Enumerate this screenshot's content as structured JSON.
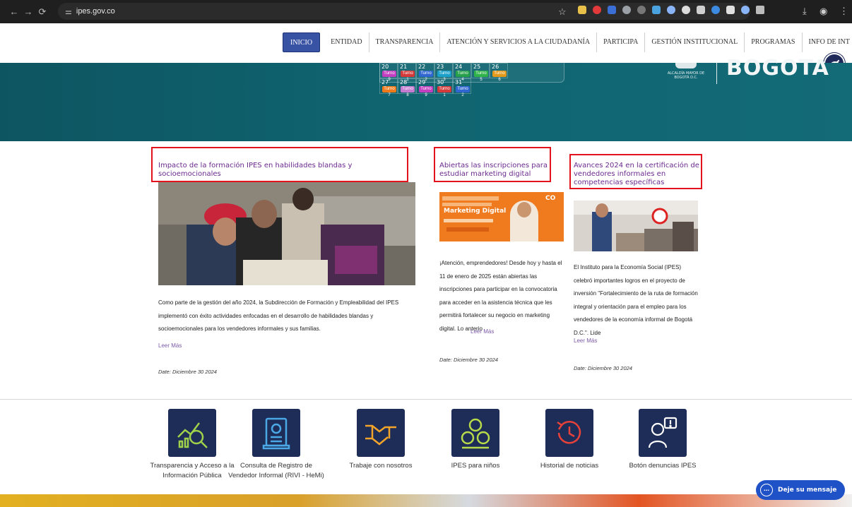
{
  "browser": {
    "url": "ipes.gov.co"
  },
  "nav": {
    "items": [
      "INICIO",
      "ENTIDAD",
      "TRANSPARENCIA",
      "ATENCIÓN Y SERVICIOS A LA CIUDADANÍA",
      "PARTICIPA",
      "GESTIÓN INSTITUCIONAL",
      "PROGRAMAS",
      "INFO DE INT"
    ]
  },
  "calendar": {
    "row1": [
      {
        "day": "20",
        "tag": "Turno 9",
        "color": "#c23fbf"
      },
      {
        "day": "21",
        "tag": "Turno 1",
        "color": "#d43a3a"
      },
      {
        "day": "22",
        "tag": "Turno 2",
        "color": "#2f66d0"
      },
      {
        "day": "23",
        "tag": "Turno 3",
        "color": "#1aa0c9"
      },
      {
        "day": "24",
        "tag": "Turno 4",
        "color": "#26a04a"
      },
      {
        "day": "25",
        "tag": "Turno 5",
        "color": "#31b34b"
      },
      {
        "day": "26",
        "tag": "Turno 6",
        "color": "#e39a1c"
      }
    ],
    "row2": [
      {
        "day": "27",
        "tag": "Turno 7",
        "color": "#f07a1a"
      },
      {
        "day": "28",
        "tag": "Turno 8",
        "color": "#c57bd0"
      },
      {
        "day": "29",
        "tag": "Turno 9",
        "color": "#c23fbf"
      },
      {
        "day": "30",
        "tag": "Turno 1",
        "color": "#d43a3a"
      },
      {
        "day": "31",
        "tag": "Turno 2",
        "color": "#2f66d0"
      }
    ]
  },
  "banner": {
    "alcaldia_text": "ALCALDÍA MAYOR DE BOGOTÁ D.C.",
    "bogota_text": "BOGOTA"
  },
  "news": [
    {
      "title": "Impacto de la formación IPES en habilidades blandas y socioemocionales",
      "body": "Como parte de la gestión del año 2024, la Subdirección de Formación y Empleabilidad del IPES implementó con éxito actividades enfocadas en el desarrollo de habilidades blandas y socioemocionales para los vendedores informales y sus familias.",
      "read_more": "Leer Más",
      "date": "Date: Diciembre 30 2024"
    },
    {
      "title": "Abiertas las inscripciones para estudiar marketing digital",
      "body": "¡Atención, emprendedores! Desde hoy y hasta el 11 de enero de 2025 están abiertas las inscripciones para participar en la convocatoria para acceder en la asistencia técnica que les permitirá fortalecer su negocio en marketing digital. Lo anterio",
      "read_more": "Leer Más",
      "date": "Date: Diciembre 30 2024",
      "promo_heading": "Marketing Digital",
      "promo_brand": "CO"
    },
    {
      "title": "Avances 2024 en la certificación de vendedores informales en competencias específicas",
      "body": "El Instituto para la Economía Social (IPES) celebró importantes logros en el proyecto de inversión \"Fortalecimiento de la ruta de formación integral y orientación para el empleo para los vendedores de la economía informal de Bogotá D.C.\". Lide",
      "read_more": "Leer Más",
      "date": "Date: Diciembre 30 2024"
    }
  ],
  "quick_links": [
    {
      "label": "Transparencia y Acceso a la Información Pública",
      "icon": "chart-magnifier-icon"
    },
    {
      "label": "Consulta de Registro de Vendedor Informal (RIVI - HeMi)",
      "icon": "registry-document-icon"
    },
    {
      "label": "Trabaje con nosotros",
      "icon": "handshake-icon"
    },
    {
      "label": "IPES para niños",
      "icon": "children-icon"
    },
    {
      "label": "Historial de noticias",
      "icon": "history-clock-icon"
    },
    {
      "label": "Botón denuncias IPES",
      "icon": "report-alert-icon"
    }
  ],
  "chat": {
    "label": "Deje su mensaje"
  },
  "colors": {
    "nav_active": "#3953a4",
    "banner_teal": "#0f6470",
    "title_purple": "#6b2a8e",
    "highlight_red": "#e0141a",
    "icon_navy": "#1d2d57",
    "chat_blue": "#1f52c7"
  }
}
